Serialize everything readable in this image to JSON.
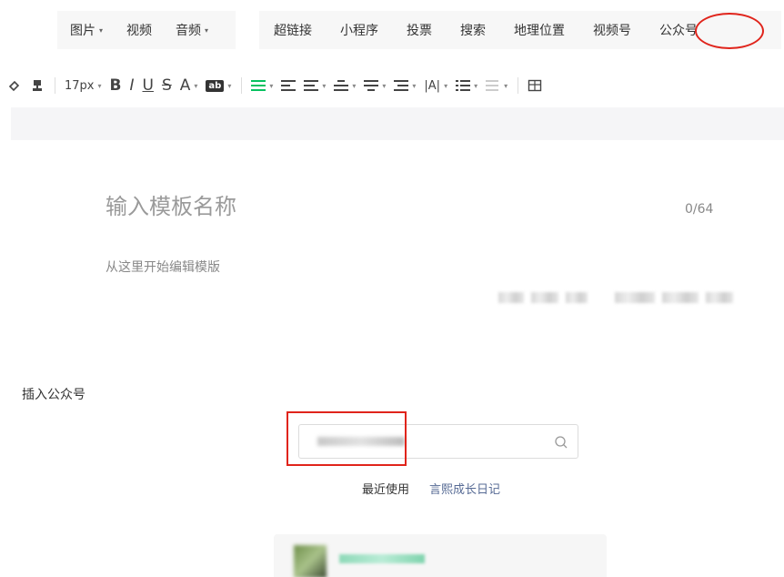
{
  "insert_menu": {
    "group1": [
      {
        "label": "图片",
        "caret": true
      },
      {
        "label": "视频",
        "caret": false
      },
      {
        "label": "音频",
        "caret": true
      }
    ],
    "group2": [
      {
        "label": "超链接"
      },
      {
        "label": "小程序"
      },
      {
        "label": "投票"
      },
      {
        "label": "搜索"
      },
      {
        "label": "地理位置"
      },
      {
        "label": "视频号"
      },
      {
        "label": "公众号"
      }
    ]
  },
  "toolbar": {
    "font_size": "17px",
    "bold": "B",
    "italic": "I",
    "underline": "U",
    "strike": "S",
    "font_color": "A",
    "bg_color": "ab",
    "line_height": "|A|"
  },
  "editor": {
    "title_placeholder": "输入模板名称",
    "title_count": "0/64",
    "body_hint": "从这里开始编辑模版"
  },
  "insert_oa": {
    "section_label": "插入公众号",
    "recent_label": "最近使用",
    "recent_account": "言熙成长日记"
  },
  "colors": {
    "accent_green": "#07c160",
    "link_blue": "#576b95",
    "highlight_red": "#e0241b"
  }
}
